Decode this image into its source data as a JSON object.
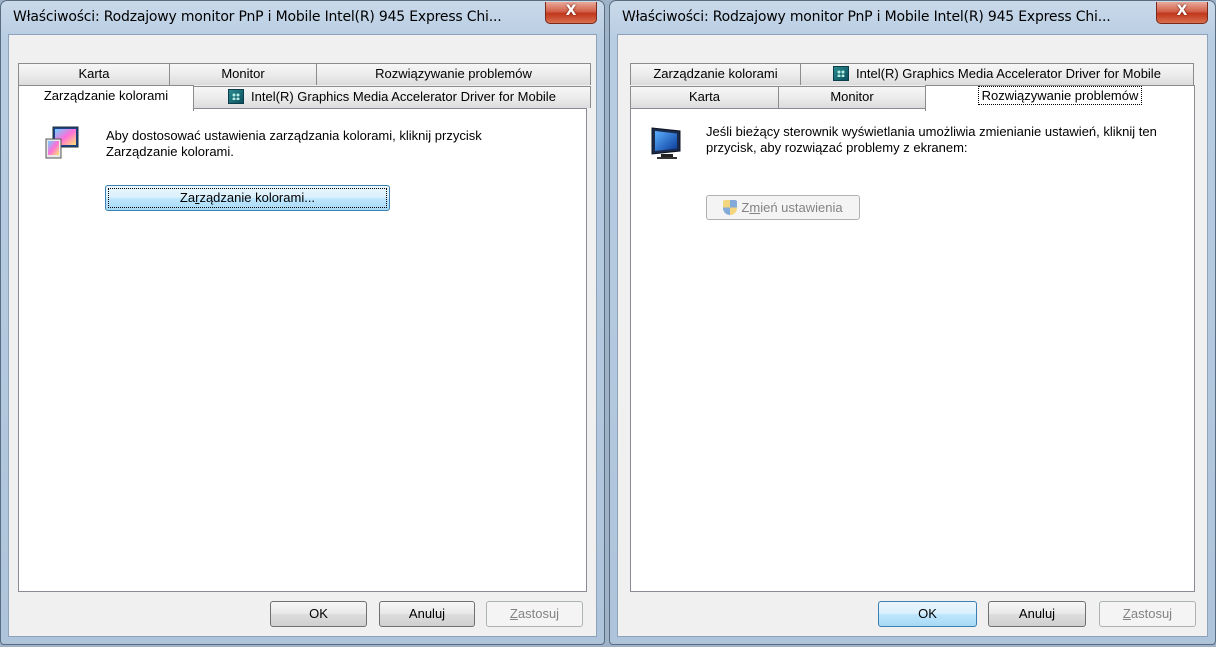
{
  "left": {
    "title": "Właściwości: Rodzajowy monitor PnP i Mobile Intel(R) 945 Express Chi...",
    "close_label": "X",
    "tabs_row1": [
      "Karta",
      "Monitor",
      "Rozwiązywanie problemów"
    ],
    "tabs_row2": [
      "Zarządzanie kolorami",
      "Intel(R) Graphics Media Accelerator Driver for Mobile"
    ],
    "active_tab": "Zarządzanie kolorami",
    "description": "Aby dostosować ustawienia zarządzania kolorami, kliknij przycisk Zarządzanie kolorami.",
    "color_button": {
      "prefix": "Za",
      "accel": "r",
      "suffix": "ządzanie kolorami..."
    },
    "ok_label": "OK",
    "cancel_label": "Anuluj",
    "apply": {
      "accel": "Z",
      "rest": "astosuj"
    }
  },
  "right": {
    "title": "Właściwości: Rodzajowy monitor PnP i Mobile Intel(R) 945 Express Chi...",
    "close_label": "X",
    "tabs_row1": [
      "Zarządzanie kolorami",
      "Intel(R) Graphics Media Accelerator Driver for Mobile"
    ],
    "tabs_row2": [
      "Karta",
      "Monitor",
      "Rozwiązywanie problemów"
    ],
    "active_tab": "Rozwiązywanie problemów",
    "description": "Jeśli bieżący sterownik wyświetlania umożliwia zmienianie ustawień, kliknij ten przycisk, aby rozwiązać problemy z ekranem:",
    "change_button": {
      "prefix": "Z",
      "accel": "m",
      "suffix": "ień ustawienia"
    },
    "ok_label": "OK",
    "cancel_label": "Anuluj",
    "apply": {
      "accel": "Z",
      "rest": "astosuj"
    }
  }
}
